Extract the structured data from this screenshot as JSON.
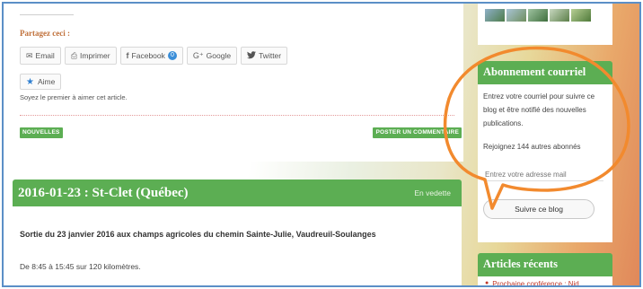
{
  "share": {
    "title": "Partagez ceci :",
    "buttons": [
      {
        "label": "Email",
        "icon": "envelope-icon"
      },
      {
        "label": "Imprimer",
        "icon": "printer-icon"
      },
      {
        "label": "Facebook",
        "icon": "facebook-icon",
        "count": "0"
      },
      {
        "label": "Google",
        "icon": "google-icon"
      },
      {
        "label": "Twitter",
        "icon": "twitter-icon"
      }
    ]
  },
  "like": {
    "label": "Aime",
    "text": "Soyez le premier à aimer cet article."
  },
  "tags": {
    "left": "NOUVELLES",
    "right": "POSTER UN COMMENTAIRE"
  },
  "post": {
    "title": "2016-01-23 : St-Clet (Québec)",
    "featured": "En vedette",
    "line1": "Sortie du 23 janvier 2016 aux champs agricoles du chemin Sainte-Julie, Vaudreuil-Soulanges",
    "line2": "De 8:45 à 15:45 sur 120 kilomètres."
  },
  "subscribe": {
    "heading": "Abonnement courriel",
    "description": "Entrez votre courriel pour suivre ce blog et être notifié des nouvelles publications.",
    "count_text": "Rejoignez 144 autres abonnés",
    "email_placeholder": "Entrez votre adresse mail",
    "button": "Suivre ce blog"
  },
  "recent": {
    "heading": "Articles récents",
    "items": [
      "Prochaine conférence : Nid"
    ]
  },
  "colors": {
    "accent_green": "#5cae53",
    "callout_orange": "#f28a2e",
    "share_title": "#c0703a"
  }
}
